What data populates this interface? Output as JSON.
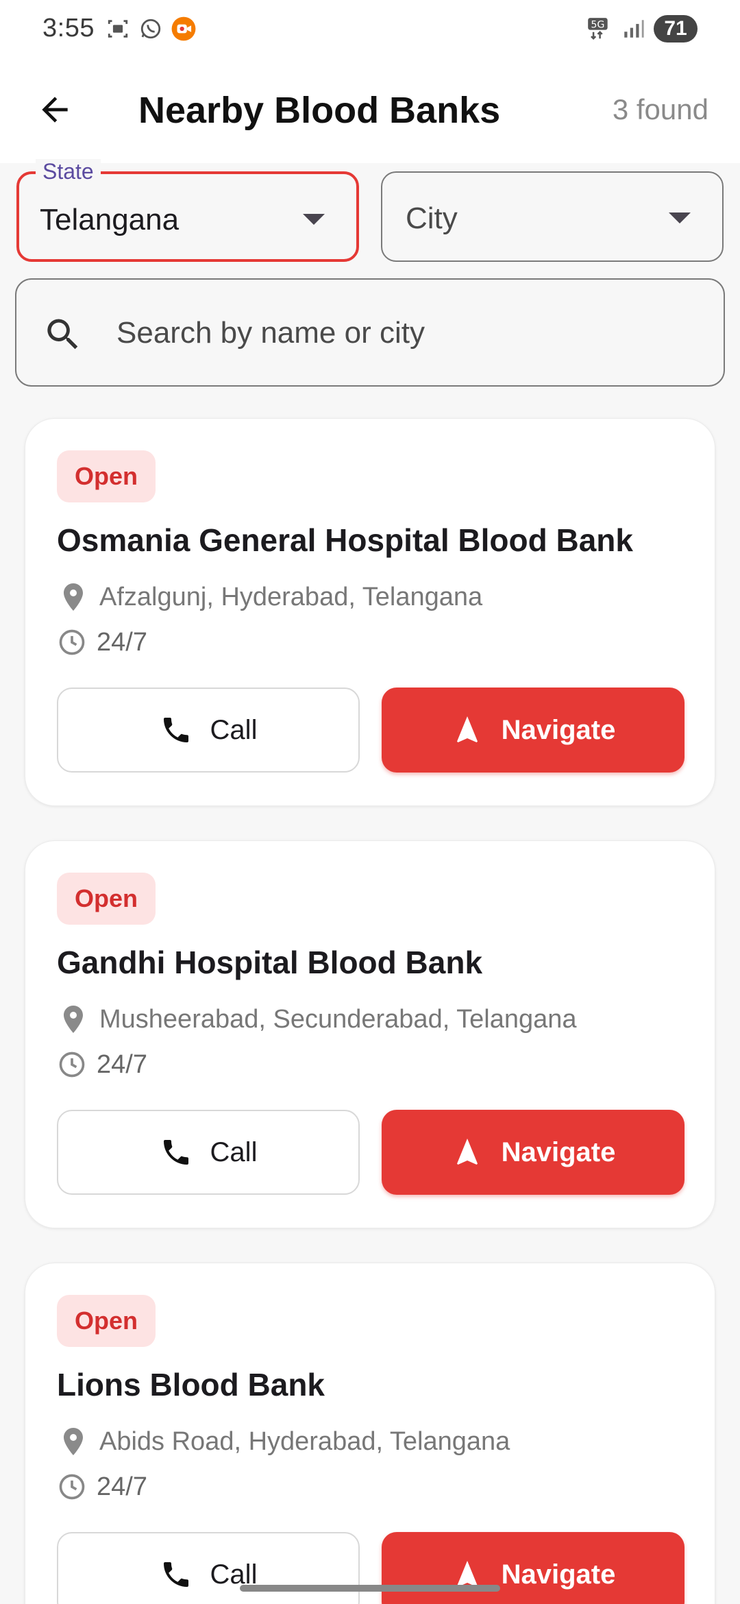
{
  "status_bar": {
    "time": "3:55",
    "left_icons": [
      "screenshot-icon",
      "whatsapp-icon",
      "screen-recorder-icon"
    ],
    "network": "5G",
    "battery": "71"
  },
  "app_bar": {
    "title": "Nearby Blood Banks",
    "found": "3 found"
  },
  "filters": {
    "state_label": "State",
    "state_value": "Telangana",
    "city_placeholder": "City"
  },
  "search": {
    "placeholder": "Search by name or city"
  },
  "banks": [
    {
      "status": "Open",
      "name": "Osmania General Hospital Blood Bank",
      "address": "Afzalgunj, Hyderabad, Telangana",
      "hours": "24/7",
      "call_label": "Call",
      "navigate_label": "Navigate"
    },
    {
      "status": "Open",
      "name": "Gandhi Hospital Blood Bank",
      "address": "Musheerabad, Secunderabad, Telangana",
      "hours": "24/7",
      "call_label": "Call",
      "navigate_label": "Navigate"
    },
    {
      "status": "Open",
      "name": "Lions Blood Bank",
      "address": "Abids Road, Hyderabad, Telangana",
      "hours": "24/7",
      "call_label": "Call",
      "navigate_label": "Navigate"
    }
  ],
  "colors": {
    "accent": "#e53935",
    "badge_bg": "#fde3e3",
    "label_purple": "#5b4ba0"
  }
}
